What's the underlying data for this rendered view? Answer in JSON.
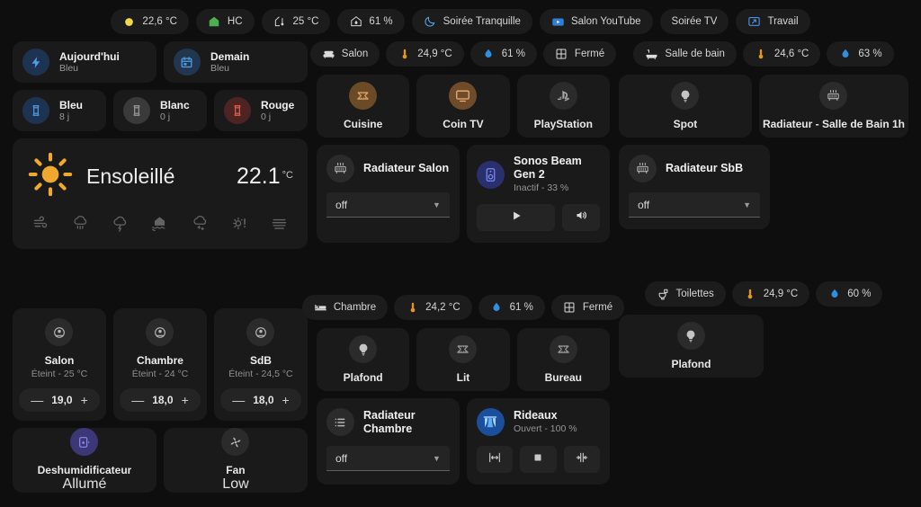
{
  "topbar": {
    "chips": [
      {
        "icon": "sun-circle-icon",
        "label": "22,6 °C"
      },
      {
        "icon": "home-lightning-icon",
        "label": "HC"
      },
      {
        "icon": "home-thermometer-icon",
        "label": "25 °C"
      },
      {
        "icon": "home-humidity-icon",
        "label": "61 %"
      },
      {
        "icon": "moon-icon",
        "label": "Soirée Tranquille"
      },
      {
        "icon": "youtube-icon",
        "label": "Salon YouTube"
      },
      {
        "icon": "none",
        "label": "Soirée TV"
      },
      {
        "icon": "desktop-icon",
        "label": "Travail"
      }
    ]
  },
  "left": {
    "tempo_today": {
      "icon": "lightning-icon",
      "title": "Aujourd'hui",
      "state": "Bleu"
    },
    "tempo_tomorrow": {
      "icon": "calendar-icon",
      "title": "Demain",
      "state": "Bleu"
    },
    "counters": [
      {
        "icon": "hourglass-icon",
        "title": "Bleu",
        "state": "8 j",
        "color": "blue"
      },
      {
        "icon": "hourglass-icon",
        "title": "Blanc",
        "state": "0 j",
        "color": "gray"
      },
      {
        "icon": "hourglass-icon",
        "title": "Rouge",
        "state": "0 j",
        "color": "red"
      }
    ],
    "weather": {
      "icon": "sunny-icon",
      "condition": "Ensoleillé",
      "temperature": "22.1",
      "unit": "°C",
      "alerts": [
        "wind-alert-icon",
        "rain-alert-icon",
        "thunderstorm-alert-icon",
        "flood-alert-icon",
        "snow-alert-icon",
        "heatwave-alert-icon",
        "fog-alert-icon"
      ]
    },
    "thermostats": [
      {
        "icon": "air-conditioner-icon",
        "name": "Salon",
        "state": "Éteint - 25 °C",
        "value": "19,0",
        "minus": "—",
        "plus": "+"
      },
      {
        "icon": "air-conditioner-icon",
        "name": "Chambre",
        "state": "Éteint - 24 °C",
        "value": "18,0",
        "minus": "—",
        "plus": "+"
      },
      {
        "icon": "air-conditioner-icon",
        "name": "SdB",
        "state": "Éteint - 24,5 °C",
        "value": "18,0",
        "minus": "—",
        "plus": "+"
      }
    ],
    "appliances": [
      {
        "icon": "dehumidifier-icon",
        "name": "Deshumidificateur",
        "state": "Allumé",
        "on": true
      },
      {
        "icon": "fan-icon",
        "name": "Fan",
        "state": "Low",
        "on": false
      }
    ]
  },
  "salon": {
    "chips": [
      {
        "icon": "sofa-icon",
        "label": "Salon"
      },
      {
        "icon": "thermometer-icon",
        "label": "24,9 °C"
      },
      {
        "icon": "water-drop-icon",
        "label": "61 %"
      },
      {
        "icon": "window-icon",
        "label": "Fermé"
      }
    ],
    "lights": [
      {
        "icon": "led-strip-icon",
        "label": "Cuisine",
        "on": true
      },
      {
        "icon": "television-icon",
        "label": "Coin TV",
        "on": true
      },
      {
        "icon": "playstation-icon",
        "label": "PlayStation",
        "on": false
      }
    ],
    "radiator": {
      "icon": "radiator-icon",
      "title": "Radiateur Salon",
      "select_value": "off"
    },
    "media": {
      "icon": "speaker-icon",
      "title": "Sonos Beam Gen 2",
      "subtitle": "Inactif - 33 %",
      "buttons": [
        "play-icon",
        "volume-icon"
      ]
    }
  },
  "bathroom": {
    "chips": [
      {
        "icon": "bathtub-icon",
        "label": "Salle de bain"
      },
      {
        "icon": "thermometer-icon",
        "label": "24,6 °C"
      },
      {
        "icon": "water-drop-icon",
        "label": "63 %"
      }
    ],
    "tiles": [
      {
        "icon": "bulb-icon",
        "label": "Spot"
      },
      {
        "icon": "radiator-icon",
        "label": "Radiateur - Salle de Bain 1h"
      }
    ],
    "radiator": {
      "icon": "radiator-icon",
      "title": "Radiateur SbB",
      "select_value": "off"
    }
  },
  "chambre": {
    "chips": [
      {
        "icon": "bed-icon",
        "label": "Chambre"
      },
      {
        "icon": "thermometer-icon",
        "label": "24,2 °C"
      },
      {
        "icon": "water-drop-icon",
        "label": "61 %"
      },
      {
        "icon": "window-icon",
        "label": "Fermé"
      }
    ],
    "lights": [
      {
        "icon": "bulb-icon",
        "label": "Plafond"
      },
      {
        "icon": "led-strip-icon",
        "label": "Lit"
      },
      {
        "icon": "led-strip-icon",
        "label": "Bureau"
      }
    ],
    "radiator": {
      "icon": "list-icon",
      "title": "Radiateur Chambre",
      "select_value": "off"
    },
    "cover": {
      "icon": "curtains-icon",
      "title": "Rideaux",
      "subtitle": "Ouvert - 100 %",
      "buttons": [
        "open-cover-icon",
        "stop-cover-icon",
        "close-cover-icon"
      ]
    }
  },
  "toilettes": {
    "chips": [
      {
        "icon": "toilet-icon",
        "label": "Toilettes"
      },
      {
        "icon": "thermometer-icon",
        "label": "24,9 °C"
      },
      {
        "icon": "water-drop-icon",
        "label": "60 %"
      }
    ],
    "lights": [
      {
        "icon": "bulb-icon",
        "label": "Plafond"
      }
    ]
  },
  "colors": {
    "background": "#0e0e0e",
    "card": "#1a1a1a",
    "chip": "#1c1c1c",
    "accent_amber": "#e8a33d",
    "accent_blue": "#3f8ee0",
    "accent_red": "#e06050",
    "accent_green": "#4caf50",
    "text_primary": "#eeeeee",
    "text_secondary": "#949494"
  }
}
